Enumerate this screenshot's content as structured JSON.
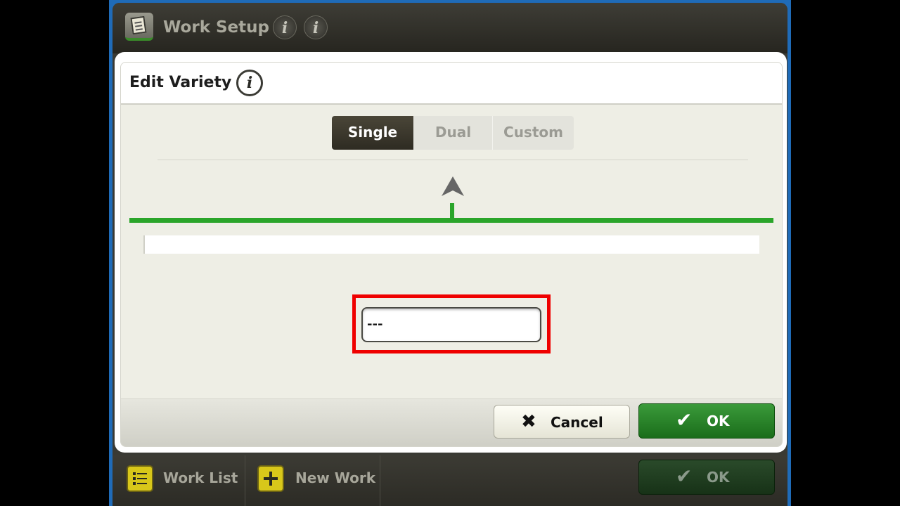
{
  "topbar": {
    "title": "Work Setup",
    "info1": "i",
    "info2": "i"
  },
  "dialog": {
    "title": "Edit Variety",
    "info": "i",
    "tabs": [
      "Single",
      "Dual",
      "Custom"
    ],
    "variety_value": "---",
    "cancel_label": "Cancel",
    "ok_label": "OK"
  },
  "bottombar": {
    "work_list_label": "Work List",
    "new_work_label": "New Work",
    "ok_label": "OK"
  },
  "colors": {
    "accent_green": "#2aa52a",
    "highlight": "#ef0000",
    "frame_blue": "#1f6bb8"
  }
}
